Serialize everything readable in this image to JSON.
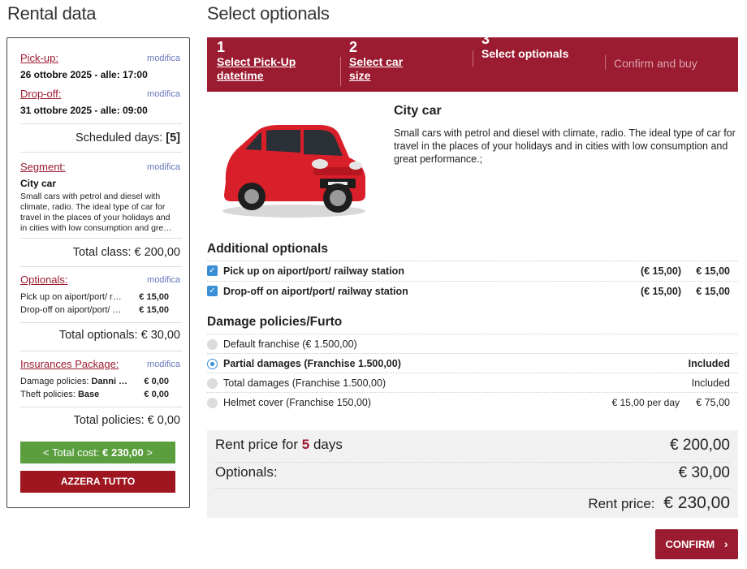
{
  "left": {
    "title": "Rental data",
    "pickup_label": "Pick-up:",
    "pickup_value": "26 ottobre 2025 - alle: 17:00",
    "dropoff_label": "Drop-off:",
    "dropoff_value": "31 ottobre 2025 - alle: 09:00",
    "modify_label": "modifica",
    "scheduled_days_label": "Scheduled days:",
    "scheduled_days_value": "[5]",
    "segment_label": "Segment:",
    "segment_name": "City car",
    "segment_desc": "Small cars with petrol and diesel with climate, radio. The ideal type of car for travel in the places of your holidays and in cities with low consumption and gre…",
    "total_class": "Total class: € 200,00",
    "optionals_label": "Optionals:",
    "optionals": [
      {
        "name": "Pick up on aiport/port/ r…",
        "price": "€ 15,00"
      },
      {
        "name": "Drop-off on aiport/port/ …",
        "price": "€ 15,00"
      }
    ],
    "total_optionals": "Total optionals: € 30,00",
    "insurances_label": "Insurances Package:",
    "insurances": [
      {
        "name": "Damage policies:",
        "value": "Danni …",
        "price": "€ 0,00"
      },
      {
        "name": "Theft policies:",
        "value": "Base",
        "price": "€ 0,00"
      }
    ],
    "total_policies": "Total policies: € 0,00",
    "total_cost_prefix": "< Total cost: ",
    "total_cost_value": "€ 230,00",
    "total_cost_suffix": " >",
    "reset_button": "AZZERA TUTTO"
  },
  "right": {
    "title": "Select optionals",
    "steps": [
      {
        "num": "1",
        "label_line1": "Select Pick-Up",
        "label_line2": "datetime"
      },
      {
        "num": "2",
        "label_line1": "Select car",
        "label_line2": "size"
      },
      {
        "num": "3",
        "label_line1": "Select optionals",
        "label_line2": ""
      },
      {
        "num": "",
        "label_line1": "Confirm and buy",
        "label_line2": ""
      }
    ],
    "car_title": "City car",
    "car_desc": "Small cars with petrol and diesel with climate, radio. The ideal type of car for travel in the places of your holidays and in cities with low consumption and great performance.;",
    "additional_heading": "Additional optionals",
    "additional": [
      {
        "label": "Pick up on aiport/port/ railway station",
        "unit": "(€ 15,00)",
        "total": "€ 15,00",
        "checked": true
      },
      {
        "label": "Drop-off on aiport/port/ railway station",
        "unit": "(€ 15,00)",
        "total": "€ 15,00",
        "checked": true
      }
    ],
    "damage_heading": "Damage policies/Furto",
    "damage": [
      {
        "label": "Default franchise (€ 1.500,00)",
        "unit": "",
        "total": "",
        "selected": false
      },
      {
        "label": "Partial damages (Franchise 1.500,00)",
        "unit": "",
        "total": "Included",
        "selected": true
      },
      {
        "label": "Total damages (Franchise 1.500,00)",
        "unit": "",
        "total": "Included",
        "selected": false
      },
      {
        "label": "Helmet cover (Franchise 150,00)",
        "unit": "€ 15,00 per day",
        "total": "€ 75,00",
        "selected": false
      }
    ],
    "summary": {
      "rent_prefix": "Rent price for ",
      "rent_days": "5",
      "rent_suffix": " days",
      "rent_value": "€ 200,00",
      "optionals_label": "Optionals:",
      "optionals_value": "€ 30,00",
      "total_label": "Rent price:",
      "total_value": "€ 230,00"
    },
    "confirm_button": "CONFIRM",
    "confirm_icon": "chevron-right-icon"
  },
  "colors": {
    "brand": "#9b1b30",
    "green": "#5a9e3e",
    "checkbox": "#3a8ed6"
  }
}
